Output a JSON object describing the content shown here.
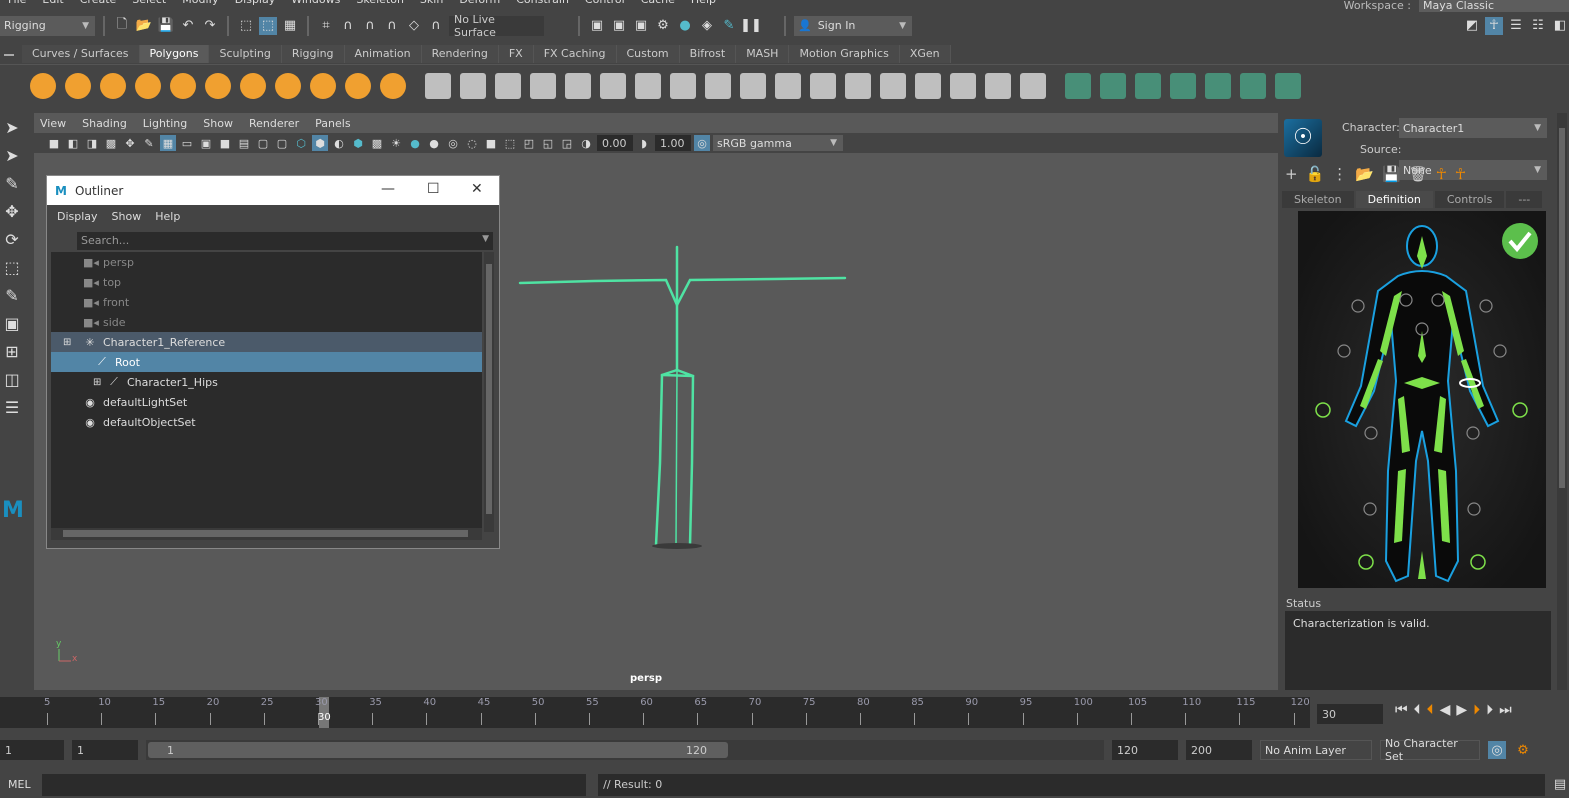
{
  "menu": [
    "File",
    "Edit",
    "Create",
    "Select",
    "Modify",
    "Display",
    "Windows",
    "Skeleton",
    "Skin",
    "Deform",
    "Constrain",
    "Control",
    "Cache",
    "Help"
  ],
  "workspace": {
    "label": "Workspace :",
    "value": "Maya Classic"
  },
  "status": {
    "mode": "Rigging",
    "live_surface": "No Live Surface",
    "sign_in": "Sign In"
  },
  "shelf_tabs": [
    "Curves / Surfaces",
    "Polygons",
    "Sculpting",
    "Rigging",
    "Animation",
    "Rendering",
    "FX",
    "FX Caching",
    "Custom",
    "Bifrost",
    "MASH",
    "Motion Graphics",
    "XGen"
  ],
  "shelf_active": "Polygons",
  "viewport": {
    "menus": [
      "View",
      "Shading",
      "Lighting",
      "Show",
      "Renderer",
      "Panels"
    ],
    "exposure": "0.00",
    "gamma": "1.00",
    "color_space": "sRGB gamma",
    "camera": "persp",
    "axis_y": "y",
    "axis_x": "x"
  },
  "outliner": {
    "title": "Outliner",
    "menus": [
      "Display",
      "Show",
      "Help"
    ],
    "search_placeholder": "Search...",
    "items": [
      {
        "label": "persp",
        "icon": "camera"
      },
      {
        "label": "top",
        "icon": "camera"
      },
      {
        "label": "front",
        "icon": "camera"
      },
      {
        "label": "side",
        "icon": "camera"
      },
      {
        "label": "Character1_Reference",
        "icon": "asterisk"
      },
      {
        "label": "Root",
        "icon": "joint"
      },
      {
        "label": "Character1_Hips",
        "icon": "joint"
      },
      {
        "label": "defaultLightSet",
        "icon": "set"
      },
      {
        "label": "defaultObjectSet",
        "icon": "set"
      }
    ]
  },
  "hik": {
    "character_label": "Character:",
    "character": "Character1",
    "source_label": "Source:",
    "source": "None",
    "tabs": [
      "Skeleton",
      "Definition",
      "Controls",
      "---"
    ],
    "active_tab": "Definition",
    "status_label": "Status",
    "status_text": "Characterization is valid."
  },
  "timeline": {
    "ticks": [
      "5",
      "10",
      "15",
      "20",
      "25",
      "30",
      "35",
      "40",
      "45",
      "50",
      "55",
      "60",
      "65",
      "70",
      "75",
      "80",
      "85",
      "90",
      "95",
      "100",
      "105",
      "110",
      "115",
      "120"
    ],
    "current_frame": "30"
  },
  "range": {
    "start": "1",
    "anim_start": "1",
    "slider_start": "1",
    "slider_end": "120",
    "anim_end": "120",
    "end": "200",
    "anim_layer": "No Anim Layer",
    "character_set": "No Character Set"
  },
  "command": {
    "label": "MEL",
    "result": "// Result: 0"
  },
  "colors": {
    "skeleton": "#4fe3a3",
    "accent": "#5285a6",
    "shelf_orange": "#f0a030",
    "hik_green": "#7ee04a"
  }
}
